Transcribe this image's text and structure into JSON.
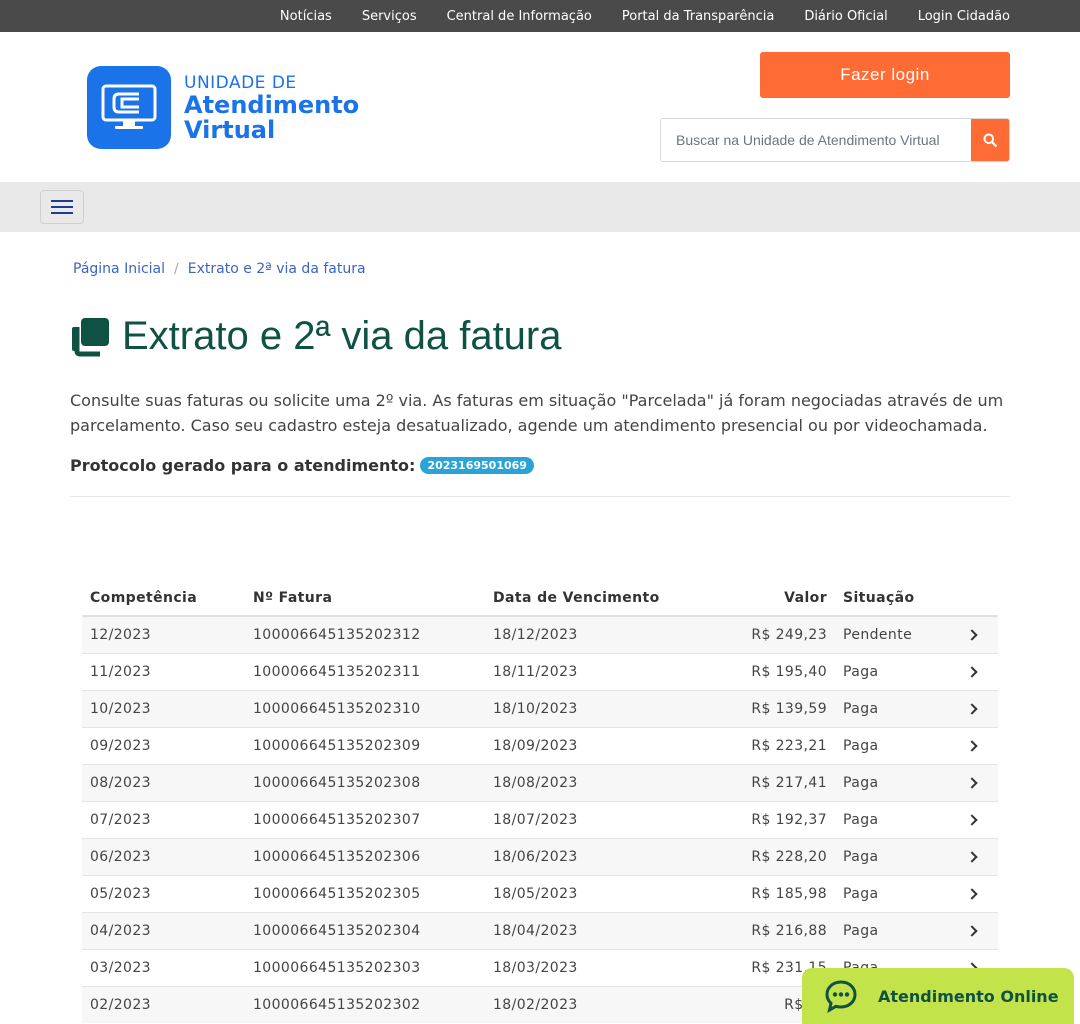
{
  "topnav": [
    "Notícias",
    "Serviços",
    "Central de Informação",
    "Portal da Transparência",
    "Diário Oficial",
    "Login Cidadão"
  ],
  "logo": {
    "line1": "UNIDADE DE",
    "line2": "Atendimento",
    "line3": "Virtual"
  },
  "header": {
    "login_label": "Fazer login",
    "search_placeholder": "Buscar na Unidade de Atendimento Virtual"
  },
  "breadcrumb": {
    "home": "Página Inicial",
    "current": "Extrato e 2ª via da fatura"
  },
  "page": {
    "title": "Extrato e 2ª via da fatura",
    "intro": "Consulte suas faturas ou solicite uma 2º via. As faturas em situação \"Parcelada\" já foram negociadas através de um parcelamento. Caso seu cadastro esteja desatualizado, agende um atendimento presencial ou por videochamada.",
    "protocol_label": "Protocolo gerado para o atendimento:",
    "protocol_number": "2023169501069"
  },
  "table": {
    "headers": [
      "Competência",
      "Nº Fatura",
      "Data de Vencimento",
      "Valor",
      "Situação"
    ],
    "rows": [
      [
        "12/2023",
        "100006645135202312",
        "18/12/2023",
        "R$ 249,23",
        "Pendente"
      ],
      [
        "11/2023",
        "100006645135202311",
        "18/11/2023",
        "R$ 195,40",
        "Paga"
      ],
      [
        "10/2023",
        "100006645135202310",
        "18/10/2023",
        "R$ 139,59",
        "Paga"
      ],
      [
        "09/2023",
        "100006645135202309",
        "18/09/2023",
        "R$ 223,21",
        "Paga"
      ],
      [
        "08/2023",
        "100006645135202308",
        "18/08/2023",
        "R$ 217,41",
        "Paga"
      ],
      [
        "07/2023",
        "100006645135202307",
        "18/07/2023",
        "R$ 192,37",
        "Paga"
      ],
      [
        "06/2023",
        "100006645135202306",
        "18/06/2023",
        "R$ 228,20",
        "Paga"
      ],
      [
        "05/2023",
        "100006645135202305",
        "18/05/2023",
        "R$ 185,98",
        "Paga"
      ],
      [
        "04/2023",
        "100006645135202304",
        "18/04/2023",
        "R$ 216,88",
        "Paga"
      ],
      [
        "03/2023",
        "100006645135202303",
        "18/03/2023",
        "R$ 231,15",
        "Paga"
      ],
      [
        "02/2023",
        "100006645135202302",
        "18/02/2023",
        "R$ 22",
        ""
      ]
    ]
  },
  "chat": {
    "label": "Atendimento Online"
  },
  "icons": {
    "search": "search-icon",
    "menu": "hamburger-icon",
    "title": "copy-icon",
    "row_action": "chevron-right-icon",
    "chat": "chat-icon",
    "logo": "monitor-icon"
  },
  "colors": {
    "accent": "#ff6b35",
    "brand_blue": "#1a73e8",
    "title_green": "#0f5142",
    "badge": "#2aa3d6",
    "chat_bg": "#c3e34b"
  }
}
